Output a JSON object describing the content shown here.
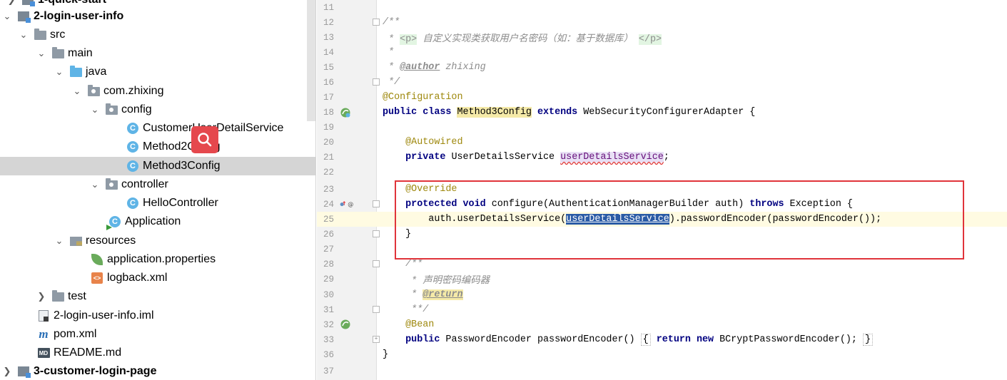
{
  "project_tree": {
    "items": [
      {
        "label": "1-quick-start",
        "arrow": "right",
        "icon": "module",
        "bold": true
      },
      {
        "label": "2-login-user-info",
        "arrow": "down",
        "icon": "module",
        "bold": true
      },
      {
        "label": "src",
        "arrow": "down",
        "icon": "folder"
      },
      {
        "label": "main",
        "arrow": "down",
        "icon": "folder"
      },
      {
        "label": "java",
        "arrow": "down",
        "icon": "folder-blue"
      },
      {
        "label": "com.zhixing",
        "arrow": "down",
        "icon": "package"
      },
      {
        "label": "config",
        "arrow": "down",
        "icon": "package"
      },
      {
        "label": "CustomerUserDetailService",
        "icon": "class"
      },
      {
        "label": "Method2Config",
        "icon": "class"
      },
      {
        "label": "Method3Config",
        "icon": "class",
        "selected": true
      },
      {
        "label": "controller",
        "arrow": "down",
        "icon": "package"
      },
      {
        "label": "HelloController",
        "icon": "class"
      },
      {
        "label": "Application",
        "icon": "class-run"
      },
      {
        "label": "resources",
        "arrow": "down",
        "icon": "resources"
      },
      {
        "label": "application.properties",
        "icon": "properties"
      },
      {
        "label": "logback.xml",
        "icon": "xml"
      },
      {
        "label": "test",
        "arrow": "right",
        "icon": "folder"
      },
      {
        "label": "2-login-user-info.iml",
        "icon": "iml"
      },
      {
        "label": "pom.xml",
        "icon": "maven"
      },
      {
        "label": "README.md",
        "icon": "markdown"
      },
      {
        "label": "3-customer-login-page",
        "arrow": "right",
        "icon": "module",
        "bold": true
      }
    ]
  },
  "editor": {
    "lines": [
      {
        "num": "11",
        "text": ""
      },
      {
        "num": "12",
        "text": "/**"
      },
      {
        "num": "13",
        "pre": " * ",
        "tag_open": "<p>",
        "mid": " 自定义实现类获取用户名密码（如：基于数据库） ",
        "tag_close": "</p>"
      },
      {
        "num": "14",
        "text": " *"
      },
      {
        "num": "15",
        "pre": " * ",
        "doctag": "@author",
        "post": " zhixing"
      },
      {
        "num": "16",
        "text": " */"
      },
      {
        "num": "17",
        "text": "@Configuration"
      },
      {
        "num": "18",
        "kw1": "public class ",
        "cls": "Method3Config",
        "kw2": " extends ",
        "rest": "WebSecurityConfigurerAdapter {"
      },
      {
        "num": "19",
        "text": ""
      },
      {
        "num": "20",
        "text": "    @Autowired"
      },
      {
        "num": "21",
        "kw": "    private ",
        "type": "UserDetailsService ",
        "field": "userDetailsService",
        "end": ";"
      },
      {
        "num": "22",
        "text": ""
      },
      {
        "num": "23",
        "text": "    @Override"
      },
      {
        "num": "24",
        "kw1": "    protected void ",
        "mid": "configure(AuthenticationManagerBuilder auth) ",
        "kw2": "throws ",
        "rest": "Exception {"
      },
      {
        "num": "25",
        "pre": "        auth.userDetailsService(",
        "sel": "userDetailsService",
        "post": ").passwordEncoder(passwordEncoder());"
      },
      {
        "num": "26",
        "text": "    }"
      },
      {
        "num": "27",
        "text": ""
      },
      {
        "num": "28",
        "text": "    /**"
      },
      {
        "num": "29",
        "text": "     * 声明密码编码器"
      },
      {
        "num": "30",
        "pre": "     * ",
        "doctag": "@return"
      },
      {
        "num": "31",
        "text": "     **/"
      },
      {
        "num": "32",
        "text": "    @Bean"
      },
      {
        "num": "33",
        "kw1": "    public ",
        "mid": "PasswordEncoder passwordEncoder() ",
        "brace_open": "{",
        "kw2": " return new ",
        "rest": "BCryptPasswordEncoder(); ",
        "brace_close": "}"
      },
      {
        "num": "36",
        "text": "}"
      },
      {
        "num": "37",
        "text": ""
      }
    ]
  },
  "colors": {
    "highlight_box": "#e0343a",
    "selection": "#2a5ba5",
    "keyword": "#000080",
    "annotation": "#9e880d",
    "comment": "#8c8c8c"
  },
  "icons": {
    "search_overlay": "search-icon",
    "bean_gutter": "spring-bean-icon",
    "override_gutter": "override-method-icon"
  }
}
